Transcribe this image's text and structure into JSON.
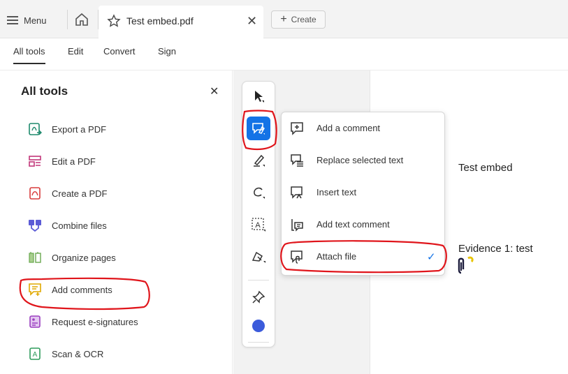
{
  "topbar": {
    "menu_label": "Menu",
    "doc_tab_title": "Test embed.pdf",
    "close_glyph": "✕",
    "create_label": "Create",
    "create_glyph": "+"
  },
  "nav": {
    "items": [
      "All tools",
      "Edit",
      "Convert",
      "Sign"
    ],
    "active": "All tools"
  },
  "panel": {
    "title": "All tools",
    "close_glyph": "✕",
    "tools": [
      {
        "label": "Export a PDF",
        "icon": "export-pdf-icon",
        "color": "#1f8a6d"
      },
      {
        "label": "Edit a PDF",
        "icon": "edit-pdf-icon",
        "color": "#c2367a"
      },
      {
        "label": "Create a PDF",
        "icon": "create-pdf-icon",
        "color": "#d83b3b"
      },
      {
        "label": "Combine files",
        "icon": "combine-files-icon",
        "color": "#5b5bd6"
      },
      {
        "label": "Organize pages",
        "icon": "organize-pages-icon",
        "color": "#6aa84f"
      },
      {
        "label": "Add comments",
        "icon": "add-comments-icon",
        "color": "#e0a800"
      },
      {
        "label": "Request e-signatures",
        "icon": "request-esign-icon",
        "color": "#9b3fbf"
      },
      {
        "label": "Scan & OCR",
        "icon": "scan-ocr-icon",
        "color": "#2e9b5c"
      }
    ]
  },
  "toolbar": {
    "tools": [
      "select-icon",
      "comment-tool-icon",
      "highlight-icon",
      "draw-icon",
      "text-select-icon",
      "shape-icon",
      "pin-icon",
      "color-dot-icon"
    ],
    "active": "comment-tool-icon",
    "accent": "#1473e6",
    "dot_color": "#3b5bdb"
  },
  "flyout": {
    "items": [
      {
        "label": "Add a comment",
        "icon": "add-comment-icon"
      },
      {
        "label": "Replace selected text",
        "icon": "replace-text-icon"
      },
      {
        "label": "Insert text",
        "icon": "insert-text-icon"
      },
      {
        "label": "Add text comment",
        "icon": "text-comment-icon"
      },
      {
        "label": "Attach file",
        "icon": "attach-file-icon",
        "checked": true
      }
    ],
    "check_glyph": "✓"
  },
  "document": {
    "line1": "Test embed",
    "line2": "Evidence 1: test"
  },
  "annotation_color": "#e0151b"
}
